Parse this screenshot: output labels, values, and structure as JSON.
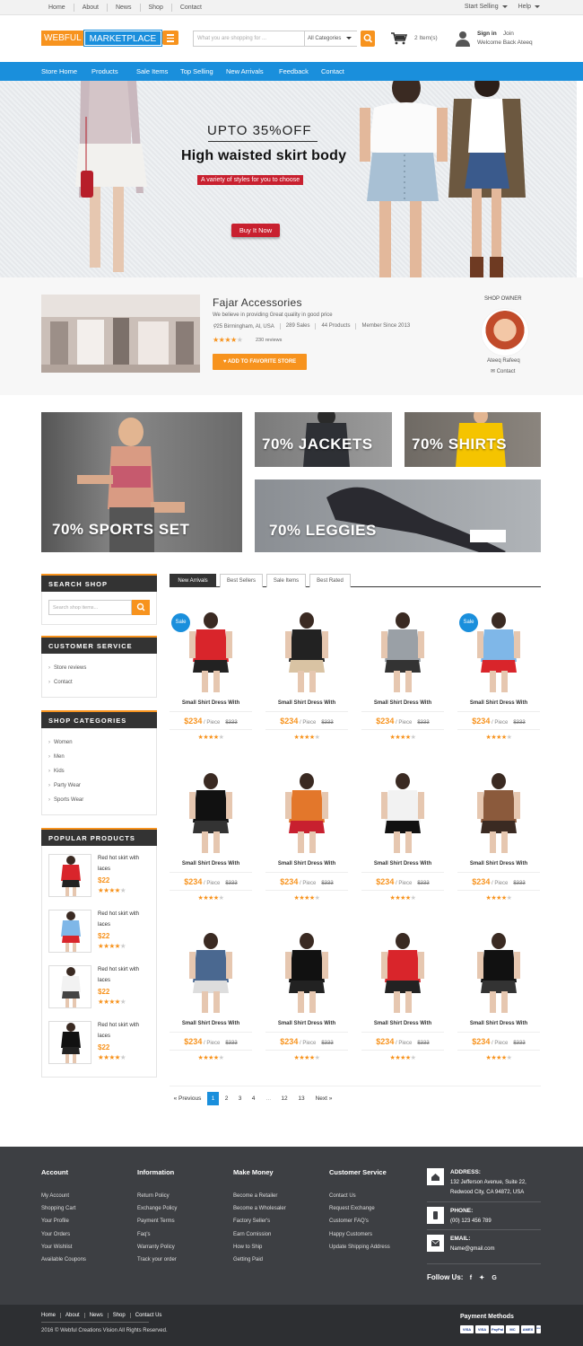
{
  "topbar": {
    "links": [
      "Home",
      "News",
      "Shop",
      "Contact"
    ],
    "about": "About",
    "start_selling": "Start Selling",
    "help": "Help"
  },
  "header": {
    "logo_part1": "WEBFUL",
    "logo_part2": "MARKETPLACE",
    "search_placeholder": "What you are shopping for ...",
    "category": "All Categories",
    "cart_count": "2 Item(s)",
    "sign_in": "Sign in",
    "join": "Join",
    "welcome": "Welcome Back Ateeq"
  },
  "nav": [
    "Store Home",
    "Products",
    "Sale Items",
    "Top Selling",
    "New Arrivals",
    "Feedback",
    "Contact"
  ],
  "hero": {
    "offer": "UPTO 35%OFF",
    "headline": "High waisted skirt body",
    "subline": "A variety of styles for you to choose",
    "cta": "Buy It Now"
  },
  "store": {
    "name": "Fajar Accessories",
    "tagline": "We believe in providing Great quality in good price",
    "location": "25 Birmingham, Al, USA",
    "sales": "289 Sales",
    "products": "44 Products",
    "member": "Member Since 2013",
    "rating": 4,
    "reviews": "230 reviews",
    "favorite_button": "ADD TO FAVORITE STORE",
    "owner_heading": "SHOP OWNER",
    "owner_name": "Ateeq Rafeeq",
    "owner_contact": "Contact"
  },
  "promos": {
    "sports": "70% SPORTS SET",
    "jackets": "70% JACKETS",
    "shirts": "70% SHIRTS",
    "leggies": "70% LEGGIES"
  },
  "sidebar": {
    "search_title": "SEARCH SHOP",
    "search_placeholder": "Search shop items...",
    "customer_service_title": "CUSTOMER SERVICE",
    "customer_service": [
      "Store reviews",
      "Contact"
    ],
    "categories_title": "SHOP CATEGORIES",
    "categories": [
      "Women",
      "Men",
      "Kids",
      "Party Wear",
      "Sports Wear"
    ],
    "popular_title": "POPULAR PRODUCTS",
    "popular": [
      {
        "name": "Red hot skirt with laces",
        "price": "$22",
        "rating": 4
      },
      {
        "name": "Red hot skirt with laces",
        "price": "$22",
        "rating": 4
      },
      {
        "name": "Red hot skirt with laces",
        "price": "$22",
        "rating": 4
      },
      {
        "name": "Red hot skirt with laces",
        "price": "$22",
        "rating": 4
      }
    ]
  },
  "tabs": [
    "New Arrivals",
    "Best Sellers",
    "Sale Items",
    "Best Rated"
  ],
  "product_common": {
    "name": "Small Shirt Dress With",
    "price": "$234",
    "unit": "/ Piece",
    "old_price": "$333",
    "rating": 4,
    "sale_badge": "Sale"
  },
  "pagination": {
    "prev": "« Previous",
    "pages": [
      "1",
      "2",
      "3",
      "4",
      "...",
      "12",
      "13"
    ],
    "next": "Next »",
    "current": "1"
  },
  "footer": {
    "account_title": "Account",
    "account": [
      "My Account",
      "Shopping Cart",
      "Your Profile",
      "Your Orders",
      "Your Wishlist",
      "Available Coupons"
    ],
    "information_title": "Information",
    "information": [
      "Return Policy",
      "Exchange Policy",
      "Payment Terms",
      "Faq's",
      "Warranty Policy",
      "Track your order"
    ],
    "make_money_title": "Make Money",
    "make_money": [
      "Become a Retailer",
      "Become a Wholesaler",
      "Factory Seller's",
      "Earn Comission",
      "How to Ship",
      "Getting Paid"
    ],
    "customer_service_title": "Customer Service",
    "customer_service": [
      "Contact Us",
      "Request Exchange",
      "Customer FAQ's",
      "Happy Customers",
      "Update Shipping Address"
    ],
    "address_label": "ADDRESS:",
    "address_line1": "132 Jefferson Avenue, Suite 22,",
    "address_line2": "Redwood City, CA 94872, USA",
    "phone_label": "PHONE:",
    "phone": "(00) 123 456 789",
    "email_label": "EMAIL:",
    "email": "Name@gmail.com",
    "follow": "Follow Us:",
    "bottom_links": [
      "Home",
      "About",
      "News",
      "Shop",
      "Contact Us"
    ],
    "copyright": "2016 © Webful Creations Vision All Rights Reserved.",
    "payment_title": "Payment Methods",
    "payment_cards": [
      "VISA",
      "VISA",
      "PayPal",
      "MC",
      "AMEX",
      "DISC"
    ]
  },
  "colors": {
    "accent": "#f7931e",
    "brand": "#1a8fdc",
    "dark": "#333333",
    "footer": "#3d3f43",
    "hero_red": "#c8202f"
  }
}
